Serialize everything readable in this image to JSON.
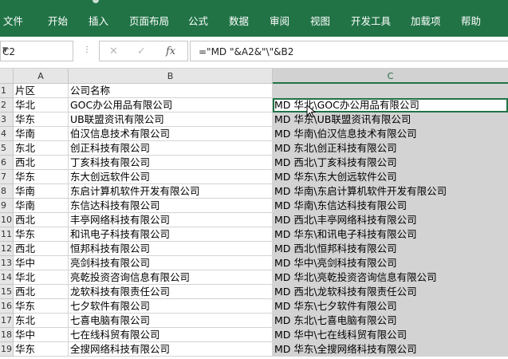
{
  "ribbon": {
    "tabs": [
      "文件",
      "开始",
      "插入",
      "页面布局",
      "公式",
      "数据",
      "审阅",
      "视图",
      "开发工具",
      "加载项",
      "帮助"
    ]
  },
  "formula_bar": {
    "name_box": "C2",
    "cancel_icon": "✕",
    "enter_icon": "✓",
    "fx_label": "fx",
    "formula": "=\"MD \"&A2&\"\\\"&B2"
  },
  "sheet": {
    "columns": [
      "A",
      "B",
      "C"
    ],
    "row_numbers": [
      "1",
      "2",
      "3",
      "4",
      "5",
      "6",
      "7",
      "8",
      "9",
      "10",
      "11",
      "12",
      "13",
      "14",
      "15",
      "16",
      "17",
      "18",
      "19"
    ],
    "rows": [
      {
        "a": "片区",
        "b": "公司名称",
        "c": ""
      },
      {
        "a": "华北",
        "b": "GOC办公用品有限公司",
        "c": "MD 华北\\GOC办公用品有限公司"
      },
      {
        "a": "华东",
        "b": "UB联盟资讯有限公司",
        "c": "MD 华东\\UB联盟资讯有限公司"
      },
      {
        "a": "华南",
        "b": "伯汉信息技术有限公司",
        "c": "MD 华南\\伯汉信息技术有限公司"
      },
      {
        "a": "东北",
        "b": "创正科技有限公司",
        "c": "MD 东北\\创正科技有限公司"
      },
      {
        "a": "西北",
        "b": "丁亥科技有限公司",
        "c": "MD 西北\\丁亥科技有限公司"
      },
      {
        "a": "华东",
        "b": "东大创远软件公司",
        "c": "MD 华东\\东大创远软件公司"
      },
      {
        "a": "华南",
        "b": "东启计算机软件开发有限公司",
        "c": "MD 华南\\东启计算机软件开发有限公司"
      },
      {
        "a": "华南",
        "b": "东信达科技有限公司",
        "c": "MD 华南\\东信达科技有限公司"
      },
      {
        "a": "西北",
        "b": "丰亭网络科技有限公司",
        "c": "MD 西北\\丰亭网络科技有限公司"
      },
      {
        "a": "华东",
        "b": "和讯电子科技有限公司",
        "c": "MD 华东\\和讯电子科技有限公司"
      },
      {
        "a": "西北",
        "b": "恒邦科技有限公司",
        "c": "MD 西北\\恒邦科技有限公司"
      },
      {
        "a": "华中",
        "b": "亮剑科技有限公司",
        "c": "MD 华中\\亮剑科技有限公司"
      },
      {
        "a": "华北",
        "b": "亮乾投资咨询信息有限公司",
        "c": "MD 华北\\亮乾投资咨询信息有限公司"
      },
      {
        "a": "西北",
        "b": "龙软科技有限责任公司",
        "c": "MD 西北\\龙软科技有限责任公司"
      },
      {
        "a": "华东",
        "b": "七夕软件有限公司",
        "c": "MD 华东\\七夕软件有限公司"
      },
      {
        "a": "东北",
        "b": "七喜电脑有限公司",
        "c": "MD 东北\\七喜电脑有限公司"
      },
      {
        "a": "华中",
        "b": "七在线科贸有限公司",
        "c": "MD 华中\\七在线科贸有限公司"
      },
      {
        "a": "华东",
        "b": "全搜网络科技有限公司",
        "c": "MD 华东\\全搜网络科技有限公司"
      }
    ]
  },
  "colors": {
    "ribbon": "#217346",
    "selection_fill": "#d3d3d3"
  }
}
